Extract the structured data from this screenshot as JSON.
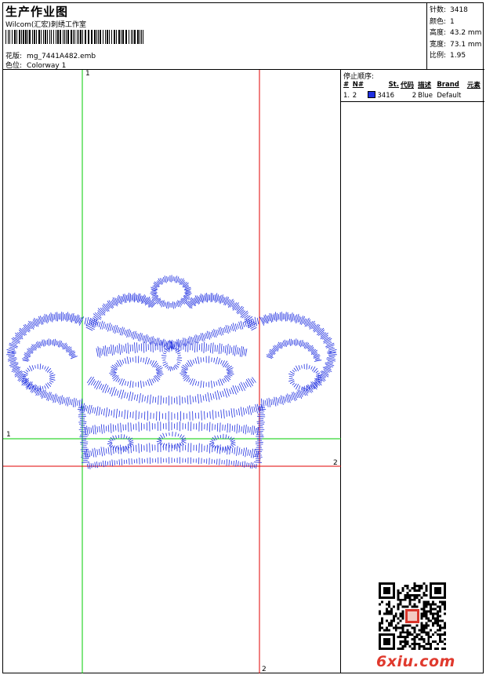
{
  "header": {
    "title": "生产作业图",
    "company": "Wilcom(汇宏)刺绣工作室",
    "design_label": "花版:",
    "design_file": "mg_7441A482.emb",
    "colorway_label": "色位:",
    "colorway": "Colorway 1"
  },
  "stats": [
    {
      "label": "针数:",
      "value": "3418"
    },
    {
      "label": "颜色:",
      "value": "1"
    },
    {
      "label": "高度:",
      "value": "43.2 mm"
    },
    {
      "label": "宽度:",
      "value": "73.1 mm"
    },
    {
      "label": "比例:",
      "value": "1.95"
    }
  ],
  "stop_sequence": {
    "title": "停止顺序:",
    "columns": [
      "#",
      "N#",
      "St.",
      "代码",
      "描述",
      "Brand",
      "元素"
    ],
    "rows": [
      {
        "index": "1.",
        "needle": "2",
        "stitches": "3416",
        "code": "2",
        "description": "Blue",
        "brand": "Default",
        "element": "",
        "color": "#1f2fe0"
      }
    ]
  },
  "guides": {
    "green_top": "1",
    "green_left": "1",
    "red_right": "2",
    "red_bottom": "2"
  },
  "watermark": "6xiu.com",
  "colors": {
    "thread": "#1f2fe0",
    "guide_green": "#00cc00",
    "guide_red": "#e00000"
  }
}
